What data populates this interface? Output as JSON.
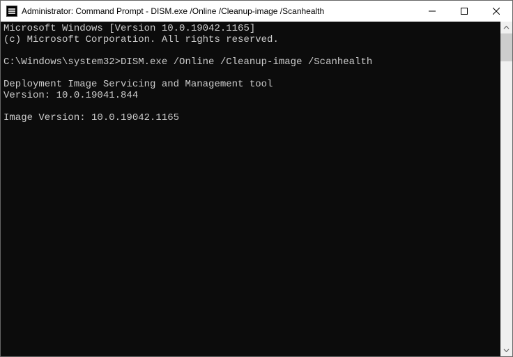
{
  "titlebar": {
    "icon_name": "cmd-icon",
    "title": "Administrator: Command Prompt - DISM.exe  /Online /Cleanup-image /Scanhealth"
  },
  "console": {
    "lines": [
      "Microsoft Windows [Version 10.0.19042.1165]",
      "(c) Microsoft Corporation. All rights reserved.",
      "",
      "C:\\Windows\\system32>DISM.exe /Online /Cleanup-image /Scanhealth",
      "",
      "Deployment Image Servicing and Management tool",
      "Version: 10.0.19041.844",
      "",
      "Image Version: 10.0.19042.1165",
      ""
    ]
  }
}
